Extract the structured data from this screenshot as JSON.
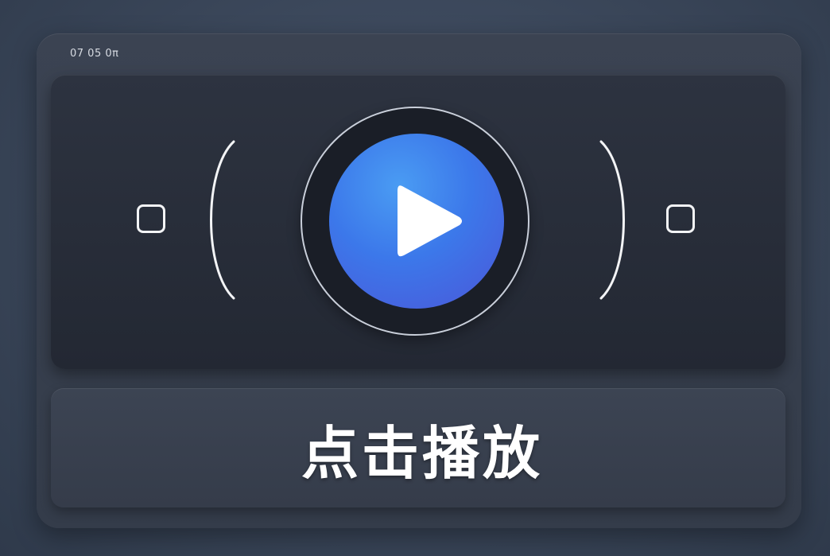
{
  "header": {
    "timestamp": "07 05 0π"
  },
  "player": {
    "left_button_icon": "square-icon",
    "right_button_icon": "square-icon",
    "play_icon": "play-icon"
  },
  "caption": {
    "label": "点击播放"
  },
  "colors": {
    "background": "#3a4659",
    "panel": "#2a303c",
    "play_blue": "#3c78ea",
    "text": "#ffffff"
  }
}
